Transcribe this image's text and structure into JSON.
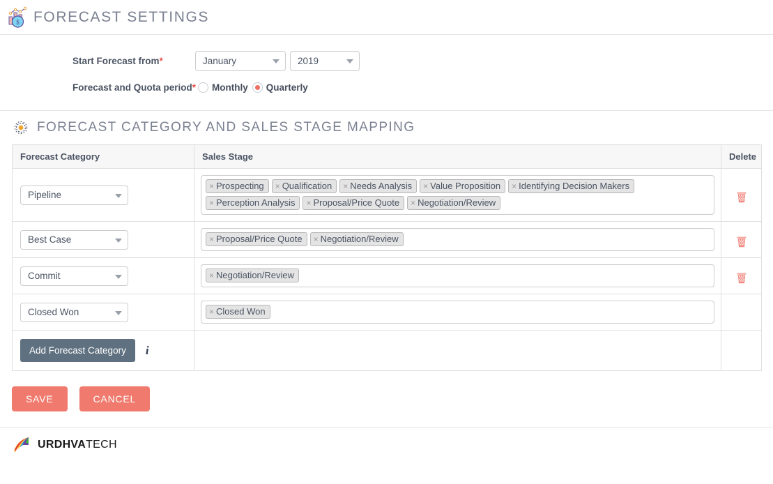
{
  "header": {
    "title": "Forecast Settings",
    "icon": "forecast-chart-coin-icon"
  },
  "form": {
    "start_label": "Start Forecast from",
    "start_required_mark": "*",
    "month_value": "January",
    "year_value": "2019",
    "period_label": "Forecast and Quota period",
    "period_required_mark": "*",
    "options": [
      {
        "label": "Monthly",
        "selected": false
      },
      {
        "label": "Quarterly",
        "selected": true
      }
    ]
  },
  "mapping_section": {
    "title": "Forecast Category and Sales Stage Mapping",
    "icon": "gear-icon",
    "columns": {
      "category": "Forecast Category",
      "stage": "Sales Stage",
      "delete": "Delete"
    },
    "rows": [
      {
        "category": "Pipeline",
        "stages": [
          "Prospecting",
          "Qualification",
          "Needs Analysis",
          "Value Proposition",
          "Identifying Decision Makers",
          "Perception Analysis",
          "Proposal/Price Quote",
          "Negotiation/Review"
        ],
        "deletable": true
      },
      {
        "category": "Best Case",
        "stages": [
          "Proposal/Price Quote",
          "Negotiation/Review"
        ],
        "deletable": true
      },
      {
        "category": "Commit",
        "stages": [
          "Negotiation/Review"
        ],
        "deletable": true
      },
      {
        "category": "Closed Won",
        "stages": [
          "Closed Won"
        ],
        "deletable": false
      }
    ],
    "add_button_label": "Add Forecast Category",
    "info_icon": "info-icon",
    "tag_remove_glyph": "×"
  },
  "actions": {
    "save_label": "Save",
    "cancel_label": "Cancel"
  },
  "footer": {
    "logo_bold": "URDHVA",
    "logo_light": "TECH",
    "logo_icon": "urdhva-fan-logo"
  },
  "colors": {
    "accent": "#ef7a6d",
    "title_text": "#7b8191",
    "add_button": "#5f7180",
    "required": "#e8524c",
    "tag_bg": "#e4e4e4",
    "trash": "#f08a82"
  }
}
